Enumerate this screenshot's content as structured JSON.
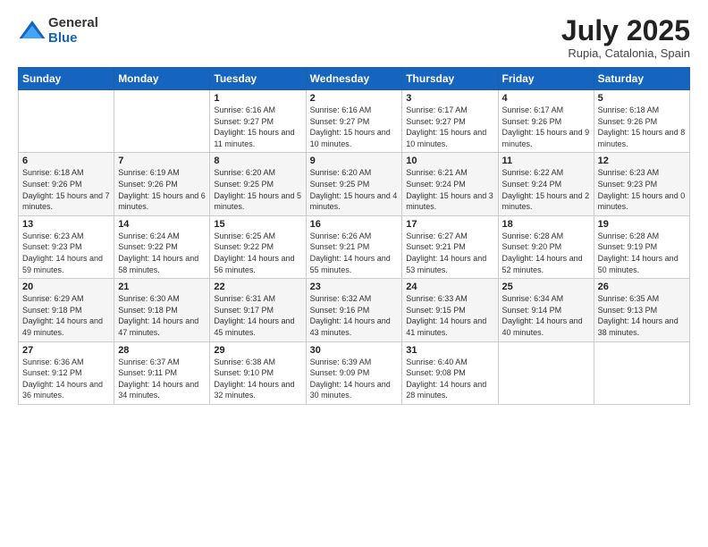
{
  "logo": {
    "general": "General",
    "blue": "Blue"
  },
  "title": {
    "month_year": "July 2025",
    "location": "Rupia, Catalonia, Spain"
  },
  "weekdays": [
    "Sunday",
    "Monday",
    "Tuesday",
    "Wednesday",
    "Thursday",
    "Friday",
    "Saturday"
  ],
  "weeks": [
    [
      {
        "day": "",
        "sunrise": "",
        "sunset": "",
        "daylight": ""
      },
      {
        "day": "",
        "sunrise": "",
        "sunset": "",
        "daylight": ""
      },
      {
        "day": "1",
        "sunrise": "Sunrise: 6:16 AM",
        "sunset": "Sunset: 9:27 PM",
        "daylight": "Daylight: 15 hours and 11 minutes."
      },
      {
        "day": "2",
        "sunrise": "Sunrise: 6:16 AM",
        "sunset": "Sunset: 9:27 PM",
        "daylight": "Daylight: 15 hours and 10 minutes."
      },
      {
        "day": "3",
        "sunrise": "Sunrise: 6:17 AM",
        "sunset": "Sunset: 9:27 PM",
        "daylight": "Daylight: 15 hours and 10 minutes."
      },
      {
        "day": "4",
        "sunrise": "Sunrise: 6:17 AM",
        "sunset": "Sunset: 9:26 PM",
        "daylight": "Daylight: 15 hours and 9 minutes."
      },
      {
        "day": "5",
        "sunrise": "Sunrise: 6:18 AM",
        "sunset": "Sunset: 9:26 PM",
        "daylight": "Daylight: 15 hours and 8 minutes."
      }
    ],
    [
      {
        "day": "6",
        "sunrise": "Sunrise: 6:18 AM",
        "sunset": "Sunset: 9:26 PM",
        "daylight": "Daylight: 15 hours and 7 minutes."
      },
      {
        "day": "7",
        "sunrise": "Sunrise: 6:19 AM",
        "sunset": "Sunset: 9:26 PM",
        "daylight": "Daylight: 15 hours and 6 minutes."
      },
      {
        "day": "8",
        "sunrise": "Sunrise: 6:20 AM",
        "sunset": "Sunset: 9:25 PM",
        "daylight": "Daylight: 15 hours and 5 minutes."
      },
      {
        "day": "9",
        "sunrise": "Sunrise: 6:20 AM",
        "sunset": "Sunset: 9:25 PM",
        "daylight": "Daylight: 15 hours and 4 minutes."
      },
      {
        "day": "10",
        "sunrise": "Sunrise: 6:21 AM",
        "sunset": "Sunset: 9:24 PM",
        "daylight": "Daylight: 15 hours and 3 minutes."
      },
      {
        "day": "11",
        "sunrise": "Sunrise: 6:22 AM",
        "sunset": "Sunset: 9:24 PM",
        "daylight": "Daylight: 15 hours and 2 minutes."
      },
      {
        "day": "12",
        "sunrise": "Sunrise: 6:23 AM",
        "sunset": "Sunset: 9:23 PM",
        "daylight": "Daylight: 15 hours and 0 minutes."
      }
    ],
    [
      {
        "day": "13",
        "sunrise": "Sunrise: 6:23 AM",
        "sunset": "Sunset: 9:23 PM",
        "daylight": "Daylight: 14 hours and 59 minutes."
      },
      {
        "day": "14",
        "sunrise": "Sunrise: 6:24 AM",
        "sunset": "Sunset: 9:22 PM",
        "daylight": "Daylight: 14 hours and 58 minutes."
      },
      {
        "day": "15",
        "sunrise": "Sunrise: 6:25 AM",
        "sunset": "Sunset: 9:22 PM",
        "daylight": "Daylight: 14 hours and 56 minutes."
      },
      {
        "day": "16",
        "sunrise": "Sunrise: 6:26 AM",
        "sunset": "Sunset: 9:21 PM",
        "daylight": "Daylight: 14 hours and 55 minutes."
      },
      {
        "day": "17",
        "sunrise": "Sunrise: 6:27 AM",
        "sunset": "Sunset: 9:21 PM",
        "daylight": "Daylight: 14 hours and 53 minutes."
      },
      {
        "day": "18",
        "sunrise": "Sunrise: 6:28 AM",
        "sunset": "Sunset: 9:20 PM",
        "daylight": "Daylight: 14 hours and 52 minutes."
      },
      {
        "day": "19",
        "sunrise": "Sunrise: 6:28 AM",
        "sunset": "Sunset: 9:19 PM",
        "daylight": "Daylight: 14 hours and 50 minutes."
      }
    ],
    [
      {
        "day": "20",
        "sunrise": "Sunrise: 6:29 AM",
        "sunset": "Sunset: 9:18 PM",
        "daylight": "Daylight: 14 hours and 49 minutes."
      },
      {
        "day": "21",
        "sunrise": "Sunrise: 6:30 AM",
        "sunset": "Sunset: 9:18 PM",
        "daylight": "Daylight: 14 hours and 47 minutes."
      },
      {
        "day": "22",
        "sunrise": "Sunrise: 6:31 AM",
        "sunset": "Sunset: 9:17 PM",
        "daylight": "Daylight: 14 hours and 45 minutes."
      },
      {
        "day": "23",
        "sunrise": "Sunrise: 6:32 AM",
        "sunset": "Sunset: 9:16 PM",
        "daylight": "Daylight: 14 hours and 43 minutes."
      },
      {
        "day": "24",
        "sunrise": "Sunrise: 6:33 AM",
        "sunset": "Sunset: 9:15 PM",
        "daylight": "Daylight: 14 hours and 41 minutes."
      },
      {
        "day": "25",
        "sunrise": "Sunrise: 6:34 AM",
        "sunset": "Sunset: 9:14 PM",
        "daylight": "Daylight: 14 hours and 40 minutes."
      },
      {
        "day": "26",
        "sunrise": "Sunrise: 6:35 AM",
        "sunset": "Sunset: 9:13 PM",
        "daylight": "Daylight: 14 hours and 38 minutes."
      }
    ],
    [
      {
        "day": "27",
        "sunrise": "Sunrise: 6:36 AM",
        "sunset": "Sunset: 9:12 PM",
        "daylight": "Daylight: 14 hours and 36 minutes."
      },
      {
        "day": "28",
        "sunrise": "Sunrise: 6:37 AM",
        "sunset": "Sunset: 9:11 PM",
        "daylight": "Daylight: 14 hours and 34 minutes."
      },
      {
        "day": "29",
        "sunrise": "Sunrise: 6:38 AM",
        "sunset": "Sunset: 9:10 PM",
        "daylight": "Daylight: 14 hours and 32 minutes."
      },
      {
        "day": "30",
        "sunrise": "Sunrise: 6:39 AM",
        "sunset": "Sunset: 9:09 PM",
        "daylight": "Daylight: 14 hours and 30 minutes."
      },
      {
        "day": "31",
        "sunrise": "Sunrise: 6:40 AM",
        "sunset": "Sunset: 9:08 PM",
        "daylight": "Daylight: 14 hours and 28 minutes."
      },
      {
        "day": "",
        "sunrise": "",
        "sunset": "",
        "daylight": ""
      },
      {
        "day": "",
        "sunrise": "",
        "sunset": "",
        "daylight": ""
      }
    ]
  ]
}
